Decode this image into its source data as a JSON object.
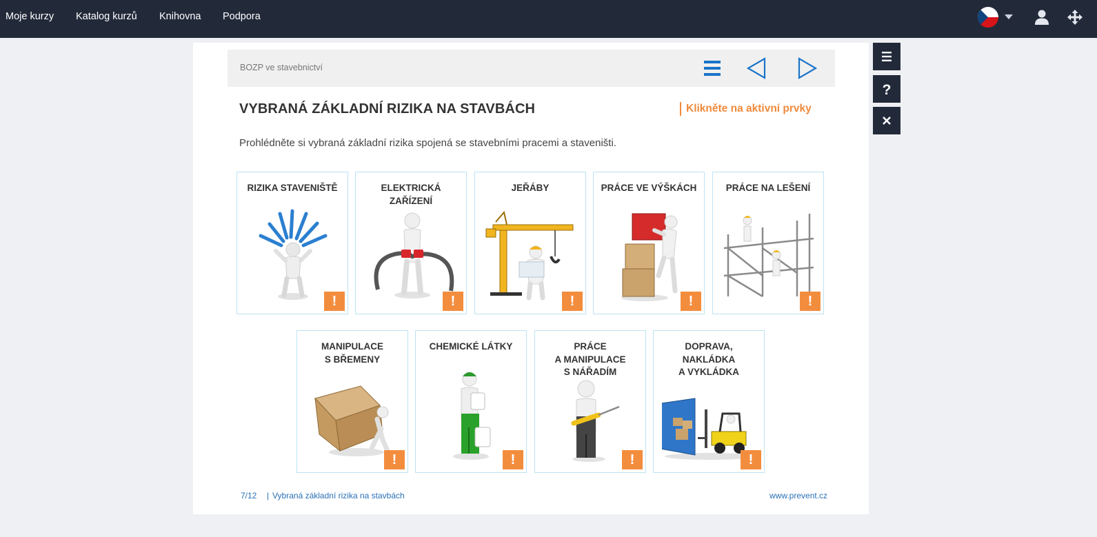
{
  "nav": {
    "links": [
      "Moje kurzy",
      "Katalog kurzů",
      "Knihovna",
      "Podpora"
    ]
  },
  "icons": {
    "language": "czech-flag-icon",
    "user": "user-icon",
    "move": "move-icon",
    "menu": "menu-icon",
    "prev": "prev-arrow-icon",
    "next": "next-arrow-icon",
    "help": "help-icon",
    "close": "close-icon",
    "alert": "exclamation-icon"
  },
  "course": {
    "title": "BOZP ve stavebnictví"
  },
  "page": {
    "title": "VYBRANÁ ZÁKLADNÍ RIZIKA NA STAVBÁCH",
    "hint": "Klikněte na aktivní prvky",
    "intro": "Prohlédněte si vybraná základní rizika spojená se stavebními pracemi a staveništi."
  },
  "cards": [
    {
      "label": "RIZIKA STAVENIŠTĚ",
      "alert": "!"
    },
    {
      "label": "ELEKTRICKÁ\nZAŘÍZENÍ",
      "alert": "!"
    },
    {
      "label": "JEŘÁBY",
      "alert": "!"
    },
    {
      "label": "PRÁCE VE VÝŠKÁCH",
      "alert": "!"
    },
    {
      "label": "PRÁCE NA LEŠENÍ",
      "alert": "!"
    },
    {
      "label": "MANIPULACE\nS BŘEMENY",
      "alert": "!"
    },
    {
      "label": "CHEMICKÉ LÁTKY",
      "alert": "!"
    },
    {
      "label": "PRÁCE\nA MANIPULACE\nS NÁŘADÍM",
      "alert": "!"
    },
    {
      "label": "DOPRAVA,\nNAKLÁDKA\nA VYKLÁDKA",
      "alert": "!"
    }
  ],
  "footer": {
    "page": "7/12",
    "separator": "|",
    "chapter": "Vybraná základní rizika na stavbách",
    "site": "www.prevent.cz"
  },
  "colors": {
    "topbar": "#222a3a",
    "accent": "#f08a3c",
    "link": "#2970b6",
    "icon_blue": "#1a73c8"
  }
}
